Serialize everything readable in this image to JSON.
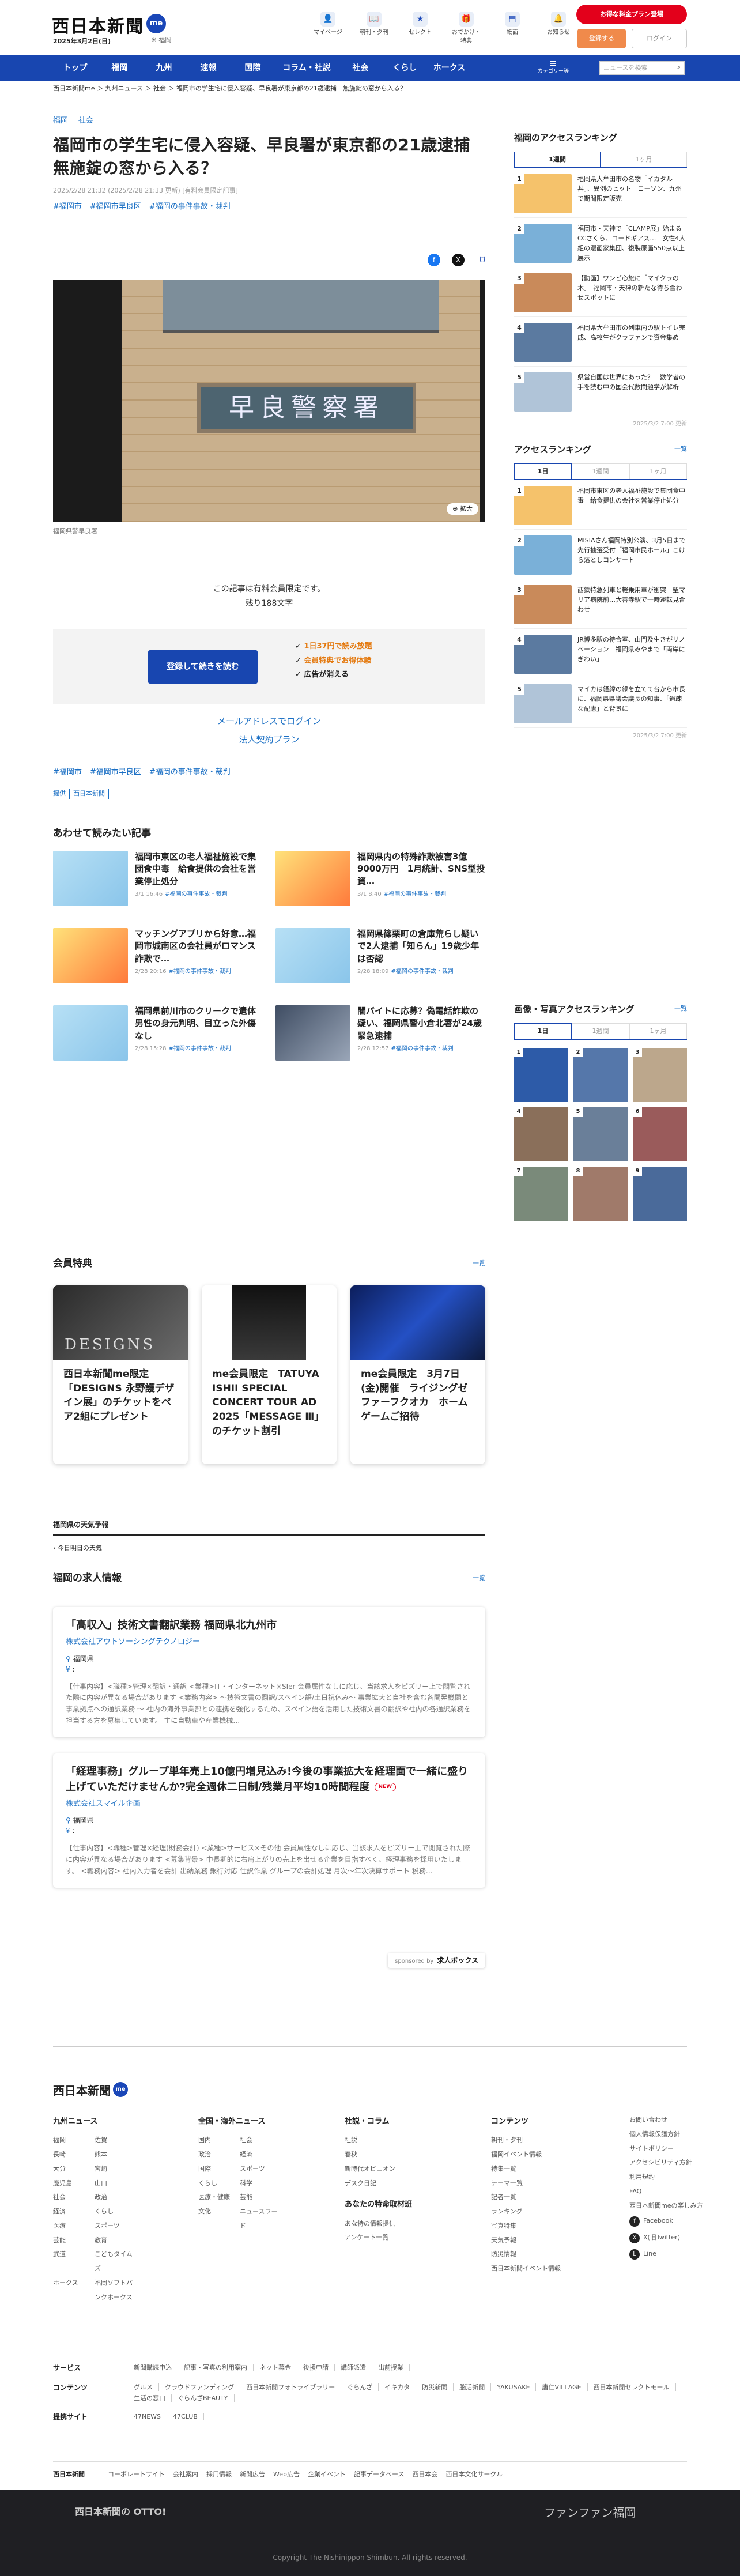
{
  "header": {
    "logo": "西日本新聞",
    "logo_badge": "me",
    "date": "2025年3月2日(日)",
    "weather": "福岡",
    "icons": [
      {
        "icon": "person-icon",
        "label": "マイページ"
      },
      {
        "icon": "book-icon",
        "label": "朝刊・夕刊"
      },
      {
        "icon": "star-icon",
        "label": "セレクト"
      },
      {
        "icon": "gift-icon",
        "label": "おでかけ・特典"
      },
      {
        "icon": "news-icon",
        "label": "紙面"
      },
      {
        "icon": "bell-icon",
        "label": "お知らせ"
      }
    ],
    "promo_button": "お得な料金プラン登場",
    "register_button": "登録する",
    "login_button": "ログイン"
  },
  "nav": {
    "items": [
      "トップ",
      "福岡",
      "九州",
      "速報",
      "国際",
      "コラム・社説",
      "社会",
      "くらし",
      "ホークス"
    ],
    "menu_label": "カテゴリー等",
    "search_placeholder": "ニュースを検索"
  },
  "breadcrumb": "西日本新聞me ＞ 九州ニュース ＞ 社会 ＞ 福岡市の学生宅に侵入容疑、早良署が東京都の21歳逮捕　無施錠の窓から入る？",
  "article": {
    "categories": [
      "福岡",
      "社会"
    ],
    "title": "福岡市の学生宅に侵入容疑、早良署が東京都の21歳逮捕　無施錠の窓から入る？",
    "meta": "2025/2/28 21:32 (2025/2/28 21:33 更新) [有料会員限定記事]",
    "tags": [
      "#福岡市",
      "#福岡市早良区",
      "#福岡の事件事故・裁判"
    ],
    "photo_sign": "早良警察署",
    "zoom_label": "拡大",
    "caption": "福岡県警早良署",
    "paywall_lines": [
      "この記事は有料会員限定です。",
      "残り188文字"
    ],
    "pay_button": "登録して続きを読む",
    "pay_features": [
      "1日37円で読み放題",
      "会員特典でお得体験",
      "広告が消える"
    ],
    "email_login": "メールアドレスでログイン",
    "corp_plan": "法人契約プラン",
    "source_label": "西日本新聞",
    "source_prefix": "提供"
  },
  "related": {
    "heading": "あわせて読みたい記事",
    "items": [
      {
        "title": "福岡市東区の老人福祉施設で集団食中毒　給食提供の会社を営業停止処分",
        "date": "3/1 16:46",
        "tag": "#福岡の事件事故・裁判",
        "img": "a"
      },
      {
        "title": "福岡県内の特殊詐欺被害3億9000万円　1月統計、SNS型投資…",
        "date": "3/1 8:40",
        "tag": "#福岡の事件事故・裁判",
        "img": "b"
      },
      {
        "title": "マッチングアプリから好意…福岡市城南区の会社員がロマンス詐欺で…",
        "date": "2/28 20:16",
        "tag": "#福岡の事件事故・裁判",
        "img": "b"
      },
      {
        "title": "福岡県篠栗町の倉庫荒らし疑いで2人逮捕「知らん」19歳少年は否認",
        "date": "2/28 18:09",
        "tag": "#福岡の事件事故・裁判",
        "img": "a"
      },
      {
        "title": "福岡県前川市のクリークで遺体　男性の身元判明、目立った外傷なし",
        "date": "2/28 15:28",
        "tag": "#福岡の事件事故・裁判",
        "img": "a"
      },
      {
        "title": "闇バイトに応募？偽電話詐欺の疑い、福岡県警小倉北署が24歳緊急逮捕",
        "date": "2/28 12:57",
        "tag": "#福岡の事件事故・裁判",
        "img": "d"
      }
    ]
  },
  "perks": {
    "heading": "会員特典",
    "more": "一覧",
    "items": [
      {
        "title": "西日本新聞me限定「DESIGNS 永野護デザイン展」のチケットをペア2組にプレゼント",
        "img_text": "DESIGNS"
      },
      {
        "title": "me会員限定　TATUYA ISHII SPECIAL CONCERT TOUR AD 2025「MESSAGE Ⅲ」のチケット割引",
        "img_text": ""
      },
      {
        "title": "me会員限定　3月7日(金)開催　ライジングゼファーフクオカ　ホームゲームご招待",
        "img_text": ""
      }
    ]
  },
  "weather": {
    "heading": "福岡県の天気予報",
    "sub": "今日明日の天気"
  },
  "jobs": {
    "heading": "福岡の求人情報",
    "more": "一覧",
    "items": [
      {
        "title": "「高収入」技術文書翻訳業務 福岡県北九州市",
        "company": "株式会社アウトソーシングテクノロジー",
        "location": "福岡県",
        "desc": "【仕事内容】<職種>管理×翻訳・通訳 <業種>IT・インターネット×SIer 会員属性なしに応じ、当該求人をピズリー上で閲覧された際に内容が異なる場合があります <業務内容> ～技術文書の翻訳/スペイン語/土日祝休み～ 事業拡大と自社を含む各開発機関と事業拠点への通訳業務 ～ 社内の海外事業部との連携を強化するため、スペイン語を活用した技術文書の翻訳や社内の各通訳業務を担当する方を募集しています。 主に自動車や産業機械…",
        "new": ""
      },
      {
        "title": "「経理事務」グループ単年売上10億円増見込み!今後の事業拡大を経理面で一緒に盛り上げていただけませんか?完全週休二日制/残業月平均10時間程度",
        "company": "株式会社スマイル企画",
        "location": "福岡県",
        "desc": "【仕事内容】<職種>管理×経理(財務会計) <業種>サービス×その他 会員属性なしに応じ、当該求人をピズリー上で閲覧された際に内容が異なる場合があります <募集背景> 中長期的に右肩上がりの売上を出せる企業を目指すべく、経理事務を採用いたします。 <職務内容> 社内入力者を会計 出納業務 銀行対応 仕訳作業 グループの会計処理 月次～年次決算サポート 税務…",
        "new": "NEW"
      }
    ],
    "sponsor_prefix": "sponsored by",
    "sponsor": "求人ボックス"
  },
  "sidebar": {
    "access_fukuoka": {
      "heading": "福岡のアクセスランキング",
      "tabs": [
        "1週間",
        "1ヶ月"
      ],
      "items": [
        {
          "rank": "1",
          "title": "福岡県大牟田市の名物「イカタル丼」、異例のヒット　ローソン、九州で期間限定販売"
        },
        {
          "rank": "2",
          "title": "福岡市・天神で「CLAMP展」始まる　CCさくら、コードギアス…　女性4人組の漫画家集団、複製原画550点以上展示"
        },
        {
          "rank": "3",
          "title": "【動画】ワンピ心旅に「マイクラの木」　福岡市・天神の新たな待ち合わせスポットに"
        },
        {
          "rank": "4",
          "title": "福岡県大牟田市の列車内の駅トイレ完成、高校生がクラファンで資金集め"
        },
        {
          "rank": "5",
          "title": "県営自国は世界にあった？　数学者の手を読む中の国会代数問題学が解析"
        }
      ],
      "updated": "2025/3/2 7:00 更新"
    },
    "access": {
      "heading": "アクセスランキング",
      "more": "一覧",
      "tabs": [
        "1日",
        "1週間",
        "1ヶ月"
      ],
      "items": [
        {
          "rank": "1",
          "title": "福岡市東区の老人福祉施設で集団食中毒　給食提供の会社を営業停止処分"
        },
        {
          "rank": "2",
          "title": "MISIAさん福岡特別公演、3月5日まで先行抽選受付「福岡市民ホール」こけら落としコンサート"
        },
        {
          "rank": "3",
          "title": "西鉄特急列車と軽乗用車が衝突　聖マリア病院前…大善寺駅で一時運転見合わせ"
        },
        {
          "rank": "4",
          "title": "JR博多駅の待合室、山門及生きがリノベーション　福岡県みやまで「両岸にぎわい」"
        },
        {
          "rank": "5",
          "title": "マイカは経緯の緑を立てて台から市長に、福岡県県議会議長の知事、「過疎な配慮」と背景に"
        }
      ],
      "updated": "2025/3/2 7:00 更新"
    },
    "photos": {
      "heading": "画像・写真アクセスランキング",
      "more": "一覧",
      "tabs": [
        "1日",
        "1週間",
        "1ヶ月"
      ],
      "ranks": [
        "1",
        "2",
        "3",
        "4",
        "5",
        "6",
        "7",
        "8",
        "9"
      ]
    }
  },
  "footer": {
    "logo": "西日本新聞",
    "logo_badge": "me",
    "columns": [
      {
        "heading": "九州ニュース",
        "items": [
          "福岡",
          "佐賀",
          "長崎",
          "熊本",
          "大分",
          "宮崎",
          "鹿児島",
          "山口",
          "社会",
          "政治",
          "経済",
          "くらし",
          "医療",
          "スポーツ",
          "芸能",
          "教育",
          "武道",
          "こどもタイムズ",
          "ホークス",
          "福岡ソフトバンクホークス"
        ]
      },
      {
        "heading": "全国・海外ニュース",
        "items": [
          "国内",
          "社会",
          "政治",
          "経済",
          "国際",
          "スポーツ",
          "くらし",
          "科学",
          "医療・健康",
          "芸能",
          "文化",
          "ニュースワード"
        ]
      },
      {
        "heading": "社説・コラム",
        "items": [
          "社説",
          "春秋",
          "新時代オピニオン",
          "デスク日記"
        ]
      },
      {
        "heading": "コンテンツ",
        "items": [
          "朝刊・夕刊",
          "福岡イベント情報",
          "特集一覧",
          "テーマ一覧",
          "記者一覧",
          "ランキング",
          "写真特集",
          "天気予報",
          "防災情報",
          "西日本新聞イベント情報"
        ]
      },
      {
        "heading": "",
        "items": [
          "お問い合わせ",
          "個人情報保護方針",
          "サイトポリシー",
          "アクセシビリティ方針",
          "利用規約",
          "FAQ",
          "西日本新聞meの楽しみ方"
        ]
      }
    ],
    "subcol_heading": "あなたの特命取材班",
    "subcol_items": [
      "あな特の情報提供",
      "アンケート一覧"
    ],
    "social": [
      "Facebook",
      "X(旧Twitter)",
      "Line"
    ],
    "service_rows": [
      {
        "label": "サービス",
        "items": [
          "新聞購読申込",
          "記事・写真の利用案内",
          "ネット募金",
          "後援申請",
          "講師派遣",
          "出前授業"
        ]
      },
      {
        "label": "コンテンツ",
        "items": [
          "グルメ",
          "クラウドファンディング",
          "西日本新聞フォトライブラリー",
          "ぐらんざ",
          "イキカタ",
          "防災新聞",
          "脳活新聞",
          "YAKUSAKE",
          "唐仁VILLAGE",
          "西日本新聞セレクトモール",
          "生活の窓口",
          "ぐらんざBEAUTY"
        ]
      },
      {
        "label": "提携サイト",
        "items": [
          "47NEWS",
          "47CLUB"
        ]
      }
    ],
    "corp_logo": "西日本新聞",
    "corp_items": [
      "コーポレートサイト",
      "会社案内",
      "採用情報",
      "新聞広告",
      "Web広告",
      "企業イベント",
      "記事データベース",
      "西日本会",
      "西日本文化サークル"
    ],
    "bottom_left": "西日本新聞の OTTO!",
    "bottom_right": "ファンファン福岡",
    "copyright": "Copyright The Nishinippon Shimbun. All rights reserved."
  }
}
